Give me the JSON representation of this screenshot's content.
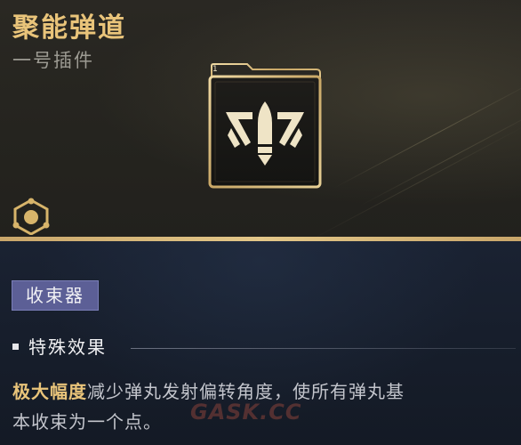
{
  "item": {
    "name": "聚能弹道",
    "slot": "一号插件",
    "corner_number": "1",
    "category_tag": "收束器"
  },
  "effect": {
    "section_label": "特殊效果",
    "highlight": "极大幅度",
    "text_line1": "减少弹丸发射偏转角度，使所有弹丸基",
    "text_line2": "本收束为一个点。"
  },
  "watermark": "GASK.CC",
  "colors": {
    "accent_gold": "#e9c47a",
    "tag_bg": "#5c5f96",
    "divider_gold": "#d8b97b"
  },
  "icons": [
    "folder-card-icon",
    "bullet-emblem-icon",
    "module-hex-icon"
  ]
}
